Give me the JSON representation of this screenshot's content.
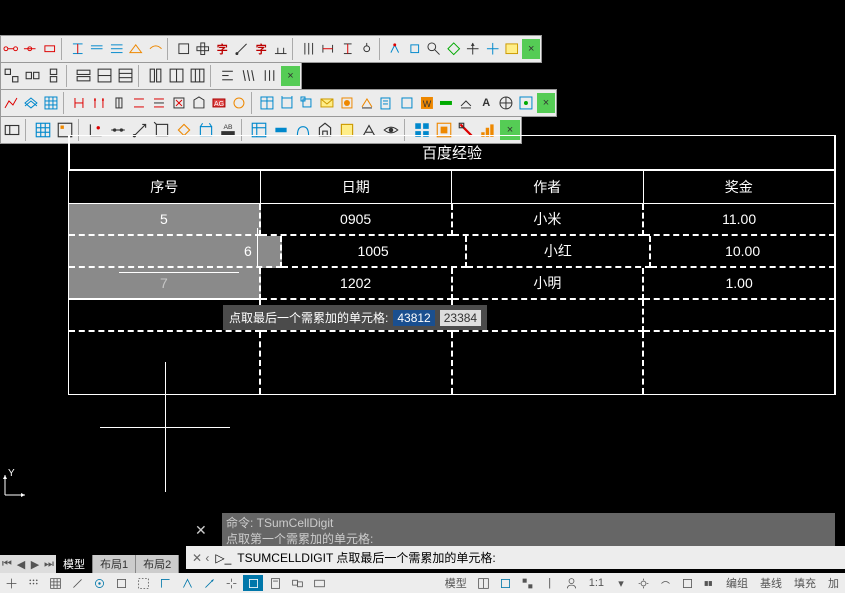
{
  "table": {
    "title": "百度经验",
    "headers": [
      "序号",
      "日期",
      "作者",
      "奖金"
    ],
    "rows": [
      [
        "5",
        "0905",
        "小米",
        "11.00"
      ],
      [
        "6",
        "1005",
        "小红",
        "10.00"
      ],
      [
        "7",
        "1202",
        "小明",
        "1.00"
      ]
    ]
  },
  "tooltip": {
    "label": "点取最后一个需累加的单元格:",
    "v1": "43812",
    "v2": "23384"
  },
  "cmd": {
    "l1": "命令: TSumCellDigit",
    "l2": "点取第一个需累加的单元格:",
    "active_prefix": "× ⟨ ▷~",
    "active": "TSUMCELLDIGIT 点取最后一个需累加的单元格:"
  },
  "tabs": {
    "model": "模型",
    "l1": "布局1",
    "l2": "布局2"
  },
  "status": {
    "model": "模型",
    "scale": "1:1",
    "grp": "编组",
    "bx": "基线",
    "fc": "填充",
    "ad": "加"
  },
  "ucs": {
    "y": "Y"
  }
}
